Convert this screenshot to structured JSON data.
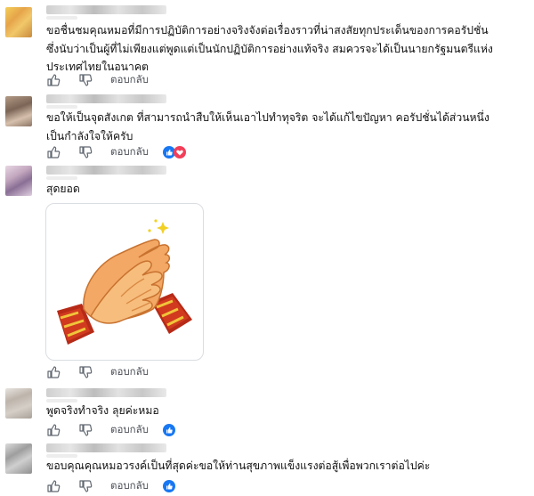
{
  "comments": [
    {
      "lines": [
        "ขอชื่นชมคุณหมอที่มีการปฏิบัติการอย่างจริงจังต่อเรื่องราวที่น่าสงสัยทุกประเด็นของการคอรัปชั่น",
        "ซึ่งนับว่าเป็นผู้ที่ไม่เพียงแต่พูดแต่เป็นนักปฏิบัติการอย่างแท้จริง สมควรจะได้เป็นนายกรัฐมนตรีแห่ง",
        "ประเทศไทยในอนาคต"
      ],
      "reply_label": "ตอบกลับ"
    },
    {
      "lines": [
        "ขอให้เป็นจุดสังเกต ที่สามารถนำสืบให้เห็นเอาไปทำทุจริต จะได้แก้ไขปัญหา คอรัปชั่นได้ส่วนหนึ่ง",
        "เป็นกำลังใจให้ครับ"
      ],
      "reply_label": "ตอบกลับ"
    },
    {
      "lines": [
        "สุดยอด"
      ],
      "reply_label": "ตอบกลับ"
    },
    {
      "lines": [
        "พูดจริงทำจริง ลุยค่ะหมอ"
      ],
      "reply_label": "ตอบกลับ"
    },
    {
      "lines": [
        "ขอบคุณคุณหมอวรงค์เป็นที่สุดค่ะขอให้ท่านสุขภาพแข็งแรงต่อสู้เพื่อพวกเราต่อไปค่ะ"
      ],
      "reply_label": "ตอบกลับ"
    }
  ],
  "icons": {
    "like": "thumbs-up-icon",
    "dislike": "thumbs-down-icon",
    "reaction_like": "like-reaction-icon",
    "reaction_love": "love-reaction-icon",
    "sticker": "clapping-hands-sticker"
  },
  "colors": {
    "like_blue": "#1877f2",
    "love_red": "#f33e58",
    "text": "#111111",
    "muted": "#4b4f56"
  }
}
